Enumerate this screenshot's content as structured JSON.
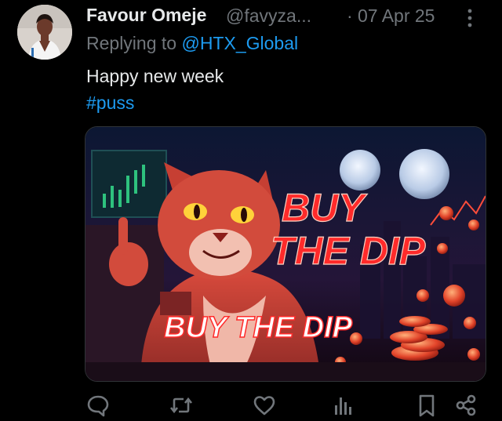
{
  "tweet": {
    "author": {
      "display_name": "Favour Omeje",
      "handle": "@favyza..."
    },
    "separator": "·",
    "timestamp": "07 Apr 25",
    "reply_prefix": "Replying to",
    "reply_handle": "@HTX_Global",
    "text": "Happy new week",
    "hashtag": "#puss",
    "media": {
      "headline_top_line1": "BUY",
      "headline_top_line2": "THE DIP",
      "headline_bottom": "BUY THE DIP"
    }
  },
  "actions": [
    {
      "name": "reply",
      "icon": "speech-bubble-icon"
    },
    {
      "name": "repost",
      "icon": "repost-arrows-icon"
    },
    {
      "name": "like",
      "icon": "heart-icon"
    },
    {
      "name": "views",
      "icon": "bar-chart-icon"
    },
    {
      "name": "bookmark",
      "icon": "bookmark-icon"
    },
    {
      "name": "share",
      "icon": "share-icon"
    }
  ],
  "colors": {
    "background": "#000000",
    "primary_text": "#e7e9ea",
    "secondary_text": "#71767b",
    "link": "#1d9bf0",
    "headline_red": "#ff2a2a"
  }
}
